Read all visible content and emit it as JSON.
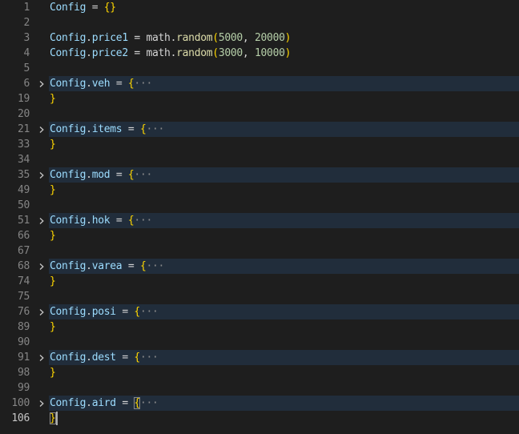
{
  "editor": {
    "active_line": "106",
    "lines": [
      {
        "num": "1",
        "folded": false,
        "tokens": [
          {
            "t": "Config",
            "c": "t-var"
          },
          {
            "t": " = ",
            "c": "t-plain"
          },
          {
            "t": "{}",
            "c": "t-brace"
          }
        ]
      },
      {
        "num": "2",
        "folded": false,
        "tokens": []
      },
      {
        "num": "3",
        "folded": false,
        "tokens": [
          {
            "t": "Config",
            "c": "t-var"
          },
          {
            "t": ".",
            "c": "t-plain"
          },
          {
            "t": "price1",
            "c": "t-prop"
          },
          {
            "t": " = ",
            "c": "t-plain"
          },
          {
            "t": "math",
            "c": "t-plain"
          },
          {
            "t": ".",
            "c": "t-plain"
          },
          {
            "t": "random",
            "c": "t-func"
          },
          {
            "t": "(",
            "c": "t-brace"
          },
          {
            "t": "5000",
            "c": "t-num"
          },
          {
            "t": ", ",
            "c": "t-plain"
          },
          {
            "t": "20000",
            "c": "t-num"
          },
          {
            "t": ")",
            "c": "t-brace"
          }
        ]
      },
      {
        "num": "4",
        "folded": false,
        "tokens": [
          {
            "t": "Config",
            "c": "t-var"
          },
          {
            "t": ".",
            "c": "t-plain"
          },
          {
            "t": "price2",
            "c": "t-prop"
          },
          {
            "t": " = ",
            "c": "t-plain"
          },
          {
            "t": "math",
            "c": "t-plain"
          },
          {
            "t": ".",
            "c": "t-plain"
          },
          {
            "t": "random",
            "c": "t-func"
          },
          {
            "t": "(",
            "c": "t-brace"
          },
          {
            "t": "3000",
            "c": "t-num"
          },
          {
            "t": ", ",
            "c": "t-plain"
          },
          {
            "t": "10000",
            "c": "t-num"
          },
          {
            "t": ")",
            "c": "t-brace"
          }
        ]
      },
      {
        "num": "5",
        "folded": false,
        "tokens": []
      },
      {
        "num": "6",
        "folded": true,
        "tokens": [
          {
            "t": "Config",
            "c": "t-var"
          },
          {
            "t": ".",
            "c": "t-plain"
          },
          {
            "t": "veh",
            "c": "t-prop"
          },
          {
            "t": " = ",
            "c": "t-plain"
          },
          {
            "t": "{",
            "c": "t-brace"
          },
          {
            "t": "···",
            "c": "t-ellipsis"
          }
        ]
      },
      {
        "num": "19",
        "folded": false,
        "tokens": [
          {
            "t": "}",
            "c": "t-brace"
          }
        ]
      },
      {
        "num": "20",
        "folded": false,
        "tokens": []
      },
      {
        "num": "21",
        "folded": true,
        "tokens": [
          {
            "t": "Config",
            "c": "t-var"
          },
          {
            "t": ".",
            "c": "t-plain"
          },
          {
            "t": "items",
            "c": "t-prop"
          },
          {
            "t": " = ",
            "c": "t-plain"
          },
          {
            "t": "{",
            "c": "t-brace"
          },
          {
            "t": "···",
            "c": "t-ellipsis"
          }
        ]
      },
      {
        "num": "33",
        "folded": false,
        "tokens": [
          {
            "t": "}",
            "c": "t-brace"
          }
        ]
      },
      {
        "num": "34",
        "folded": false,
        "tokens": []
      },
      {
        "num": "35",
        "folded": true,
        "tokens": [
          {
            "t": "Config",
            "c": "t-var"
          },
          {
            "t": ".",
            "c": "t-plain"
          },
          {
            "t": "mod",
            "c": "t-prop"
          },
          {
            "t": " = ",
            "c": "t-plain"
          },
          {
            "t": "{",
            "c": "t-brace"
          },
          {
            "t": "···",
            "c": "t-ellipsis"
          }
        ]
      },
      {
        "num": "49",
        "folded": false,
        "tokens": [
          {
            "t": "}",
            "c": "t-brace"
          }
        ]
      },
      {
        "num": "50",
        "folded": false,
        "tokens": []
      },
      {
        "num": "51",
        "folded": true,
        "tokens": [
          {
            "t": "Config",
            "c": "t-var"
          },
          {
            "t": ".",
            "c": "t-plain"
          },
          {
            "t": "hok",
            "c": "t-prop"
          },
          {
            "t": " = ",
            "c": "t-plain"
          },
          {
            "t": "{",
            "c": "t-brace"
          },
          {
            "t": "···",
            "c": "t-ellipsis"
          }
        ]
      },
      {
        "num": "66",
        "folded": false,
        "tokens": [
          {
            "t": "}",
            "c": "t-brace"
          }
        ]
      },
      {
        "num": "67",
        "folded": false,
        "tokens": []
      },
      {
        "num": "68",
        "folded": true,
        "tokens": [
          {
            "t": "Config",
            "c": "t-var"
          },
          {
            "t": ".",
            "c": "t-plain"
          },
          {
            "t": "varea",
            "c": "t-prop"
          },
          {
            "t": " = ",
            "c": "t-plain"
          },
          {
            "t": "{",
            "c": "t-brace"
          },
          {
            "t": "···",
            "c": "t-ellipsis"
          }
        ]
      },
      {
        "num": "74",
        "folded": false,
        "tokens": [
          {
            "t": "}",
            "c": "t-brace"
          }
        ]
      },
      {
        "num": "75",
        "folded": false,
        "tokens": []
      },
      {
        "num": "76",
        "folded": true,
        "tokens": [
          {
            "t": "Config",
            "c": "t-var"
          },
          {
            "t": ".",
            "c": "t-plain"
          },
          {
            "t": "posi",
            "c": "t-prop"
          },
          {
            "t": " = ",
            "c": "t-plain"
          },
          {
            "t": "{",
            "c": "t-brace"
          },
          {
            "t": "···",
            "c": "t-ellipsis"
          }
        ]
      },
      {
        "num": "89",
        "folded": false,
        "tokens": [
          {
            "t": "}",
            "c": "t-brace"
          }
        ]
      },
      {
        "num": "90",
        "folded": false,
        "tokens": []
      },
      {
        "num": "91",
        "folded": true,
        "tokens": [
          {
            "t": "Config",
            "c": "t-var"
          },
          {
            "t": ".",
            "c": "t-plain"
          },
          {
            "t": "dest",
            "c": "t-prop"
          },
          {
            "t": " = ",
            "c": "t-plain"
          },
          {
            "t": "{",
            "c": "t-brace"
          },
          {
            "t": "···",
            "c": "t-ellipsis"
          }
        ]
      },
      {
        "num": "98",
        "folded": false,
        "tokens": [
          {
            "t": "}",
            "c": "t-brace"
          }
        ]
      },
      {
        "num": "99",
        "folded": false,
        "tokens": []
      },
      {
        "num": "100",
        "folded": true,
        "tokens": [
          {
            "t": "Config",
            "c": "t-var"
          },
          {
            "t": ".",
            "c": "t-plain"
          },
          {
            "t": "aird",
            "c": "t-prop"
          },
          {
            "t": " = ",
            "c": "t-plain"
          },
          {
            "t": "{",
            "c": "t-brace matched"
          },
          {
            "t": "···",
            "c": "t-ellipsis"
          }
        ]
      },
      {
        "num": "106",
        "folded": false,
        "cursor": true,
        "tokens": [
          {
            "t": "}",
            "c": "t-brace matched"
          }
        ]
      }
    ]
  },
  "icons": {
    "fold": "chevron-right-icon"
  }
}
